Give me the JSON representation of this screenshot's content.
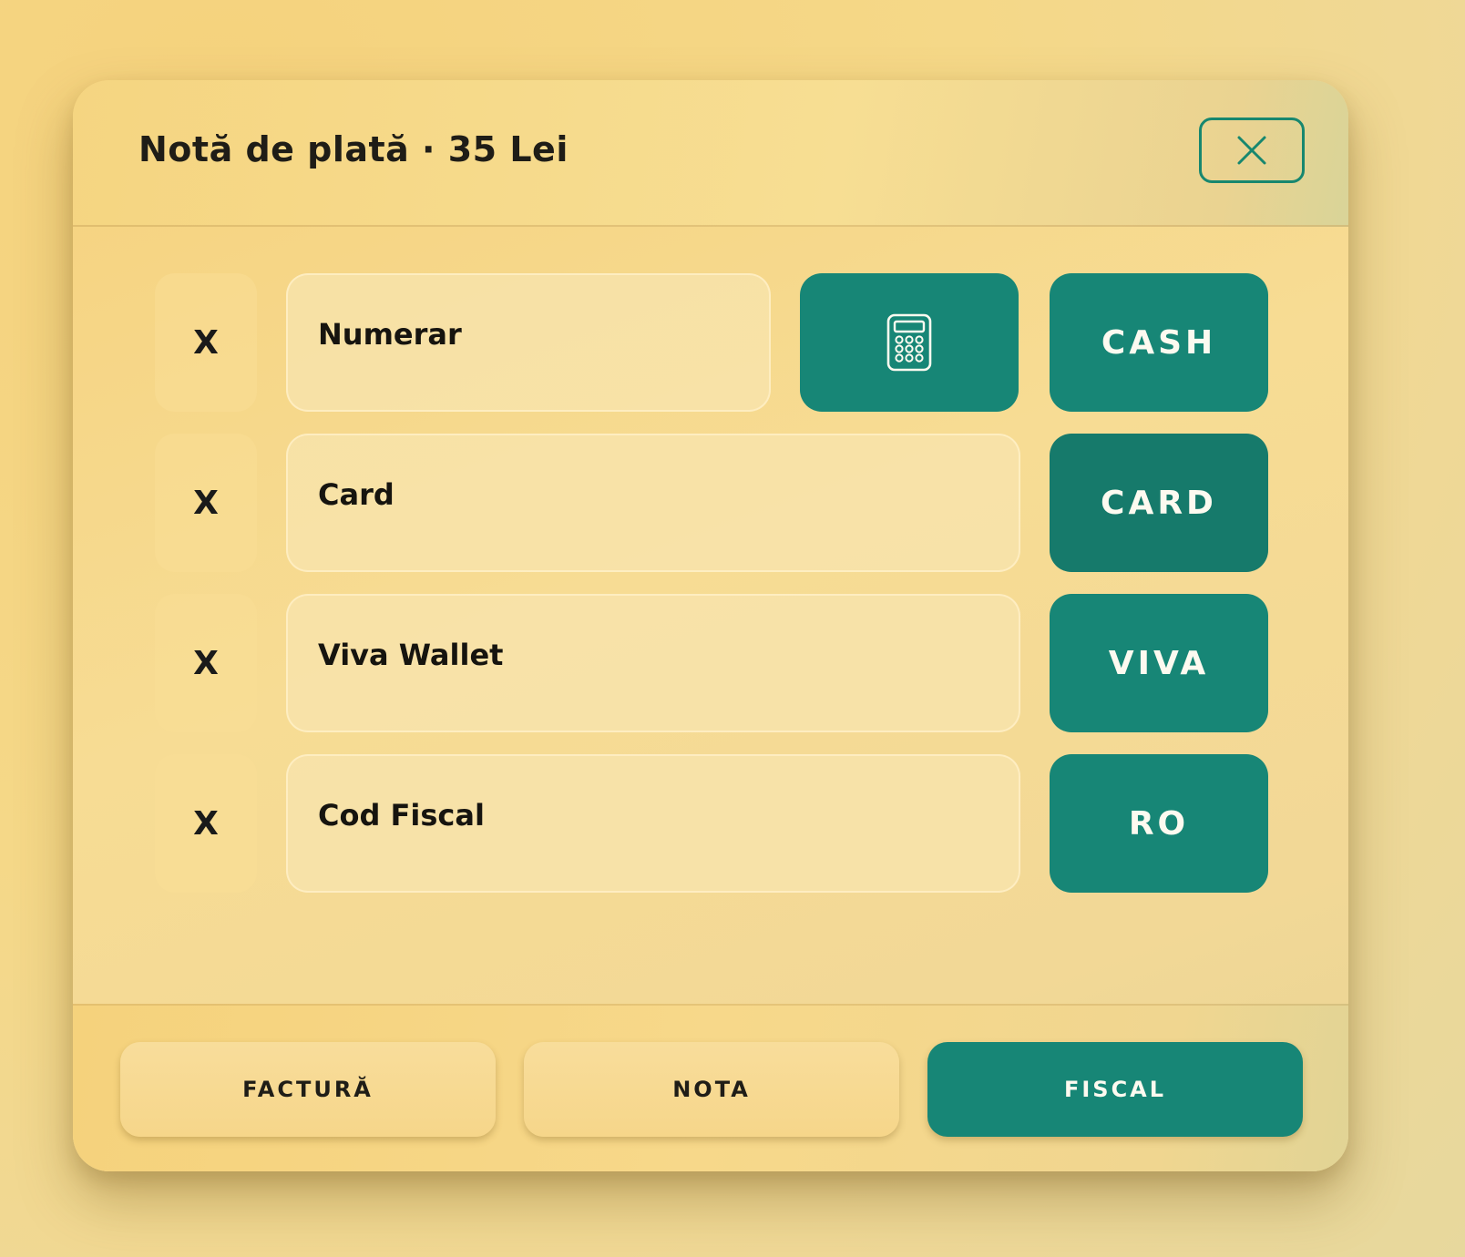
{
  "dialog": {
    "title": "Notă de plată · 35 Lei"
  },
  "rows": [
    {
      "delete_label": "X",
      "field_value": "Numerar",
      "button_label": "CASH"
    },
    {
      "delete_label": "X",
      "field_value": "Card",
      "button_label": "CARD"
    },
    {
      "delete_label": "X",
      "field_value": "Viva Wallet",
      "button_label": "VIVA"
    },
    {
      "delete_label": "X",
      "field_value": "Cod Fiscal",
      "button_label": "RO"
    }
  ],
  "footer": {
    "factura_label": "FACTURĂ",
    "nota_label": "NOTA",
    "fiscal_label": "FISCAL"
  },
  "colors": {
    "accent": "#178676",
    "accent_selected": "#167a6b",
    "background": "#f5d888",
    "text": "#1f1d17"
  },
  "icons": {
    "close": "close-icon",
    "calculator": "calculator-icon"
  }
}
